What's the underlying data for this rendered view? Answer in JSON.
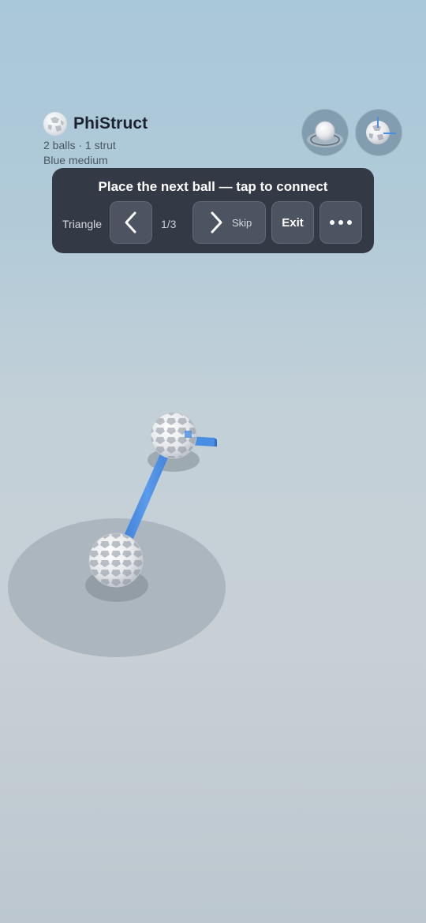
{
  "app": {
    "title": "PhiStruct",
    "stats": "2 balls · 1 strut",
    "material": "Blue medium"
  },
  "toolbar": {
    "ball_mode_icon": "sphere-on-plate-icon",
    "view_mode_icon": "ball-with-axis-icon"
  },
  "guide": {
    "instruction": "Place the next ball — tap to connect",
    "pattern": "Triangle",
    "step": "1/3",
    "prev_icon": "chevron-left-icon",
    "next_icon": "chevron-right-icon",
    "skip_label": "Skip",
    "exit_label": "Exit",
    "more_icon": "ellipsis-icon"
  },
  "colors": {
    "strut": "#4a8ee4",
    "panel": "#282e38",
    "ball": "#eceef1"
  }
}
